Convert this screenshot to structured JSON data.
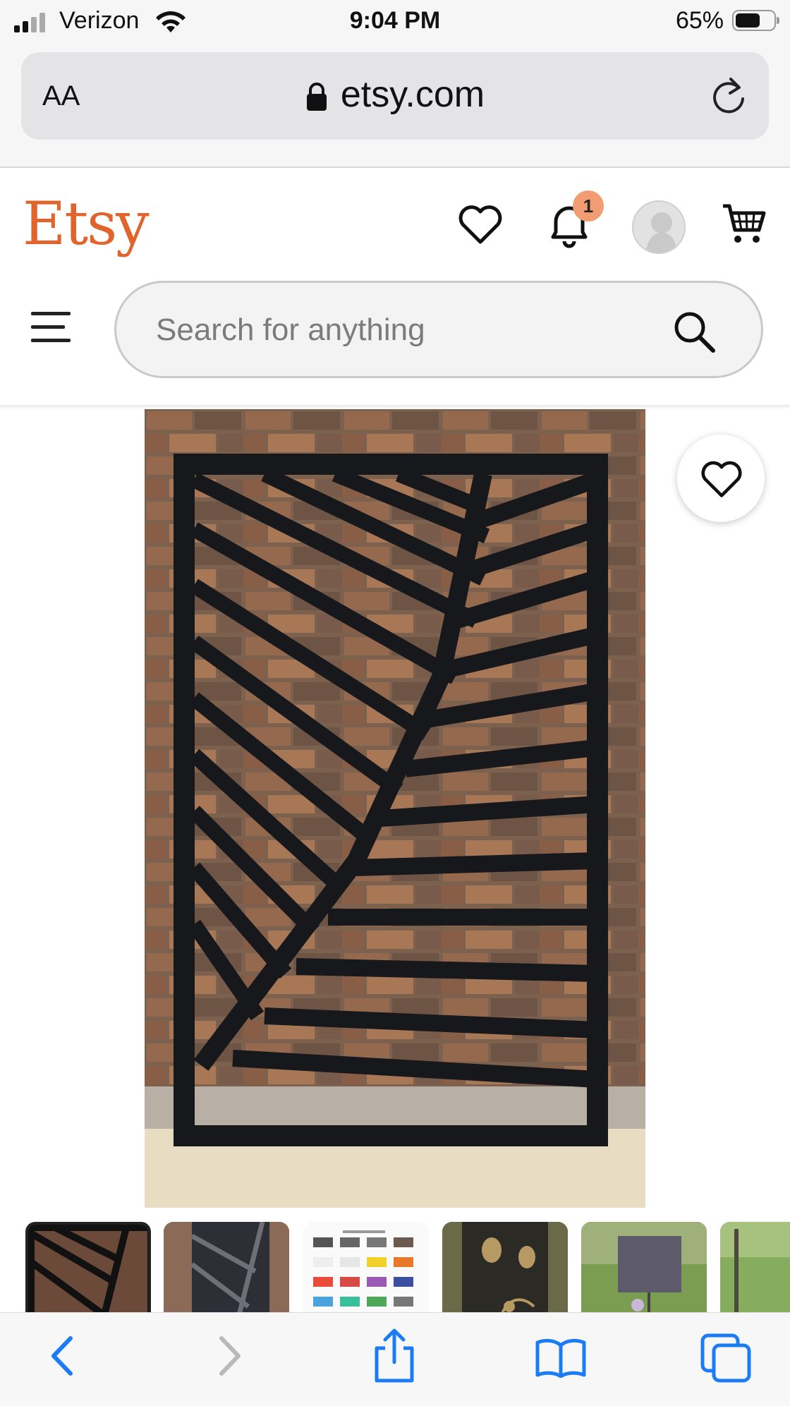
{
  "status_bar": {
    "carrier": "Verizon",
    "time": "9:04 PM",
    "battery": "65%"
  },
  "browser": {
    "text_size_label": "AA",
    "domain": "etsy.com"
  },
  "header": {
    "logo": "Etsy",
    "notification_count": "1"
  },
  "search": {
    "placeholder": "Search for anything"
  },
  "product": {
    "image_icon": "palm-leaf-metal-panel",
    "thumbnails": [
      "leaf-panel-black",
      "leaf-panel-on-brick",
      "color-options-chart",
      "butterfly-floral-panel",
      "panel-on-lawn",
      "garden-scene"
    ]
  },
  "colors": {
    "brand": "#e1642c",
    "badge": "#f19c72",
    "ios_blue": "#1b7cf5"
  }
}
